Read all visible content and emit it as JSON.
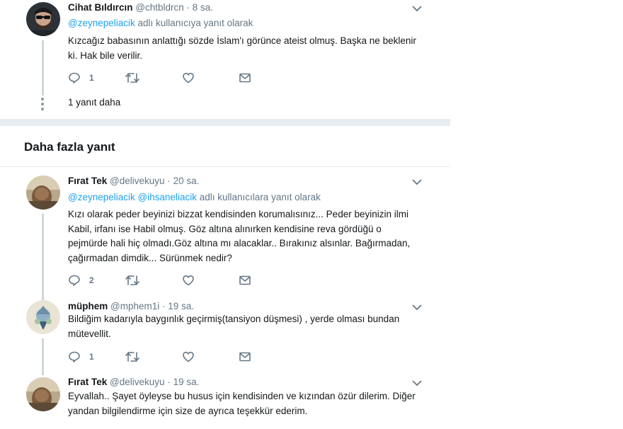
{
  "tweets": [
    {
      "name": "Cihat Bıldırcın",
      "handle": "@chtbldrcn",
      "time": "8 sa.",
      "reply_prefix": "@zeynepeliacik",
      "reply_suffix": "adlı kullanıcıya yanıt olarak",
      "text": [
        "Kızcağız babasının anlattığı sözde İslam'ı görünce ateist olmuş. Başka ne beklenir",
        "ki. Hak bile verilir."
      ],
      "reply_count": "1"
    },
    {
      "name": "Fırat Tek",
      "handle": "@delivekuyu",
      "time": "20 sa.",
      "reply_prefix": "@zeynepeliacik @ihsaneliacik",
      "reply_suffix": "adlı kullanıcılara yanıt olarak",
      "text": [
        "Kızı olarak peder beyinizi bizzat kendisinden korumalısınız... Peder beyinizin ilmi",
        "Kabil, irfanı ise Habil olmuş. Göz altına alınırken kendisine reva gördüğü o",
        "pejmürde hali hiç olmadı.Göz altına mı alacaklar.. Bırakınız alsınlar. Bağırmadan,",
        "çağırmadan dimdik... Sürünmek nedir?"
      ],
      "reply_count": "2"
    },
    {
      "name": "müphem",
      "handle": "@mphem1i",
      "time": "19 sa.",
      "text": [
        "Bildiğim kadarıyla baygınlık geçirmiş(tansiyon düşmesi) , yerde olması bundan",
        "mütevellit."
      ],
      "reply_count": "1"
    },
    {
      "name": "Fırat Tek",
      "handle": "@delivekuyu",
      "time": "19 sa.",
      "text": [
        "Eyvallah.. Şayet öyleyse bu husus için kendisinden ve kızından özür dilerim. Diğer",
        "yandan bilgilendirme için size de ayrıca teşekkür ederim."
      ]
    }
  ],
  "more_replies_link": "1 yanıt daha",
  "section_title": "Daha fazla yanıt",
  "separator_dot": "·",
  "colors": {
    "muted": "#657786",
    "mention": "#1da1f2",
    "thread_line": "#ccd6dd",
    "divider": "#e6ecf0"
  },
  "icons": {
    "reply": "reply-icon",
    "retweet": "retweet-icon",
    "like": "heart-icon",
    "dm": "envelope-icon",
    "caret": "chevron-down-icon"
  }
}
